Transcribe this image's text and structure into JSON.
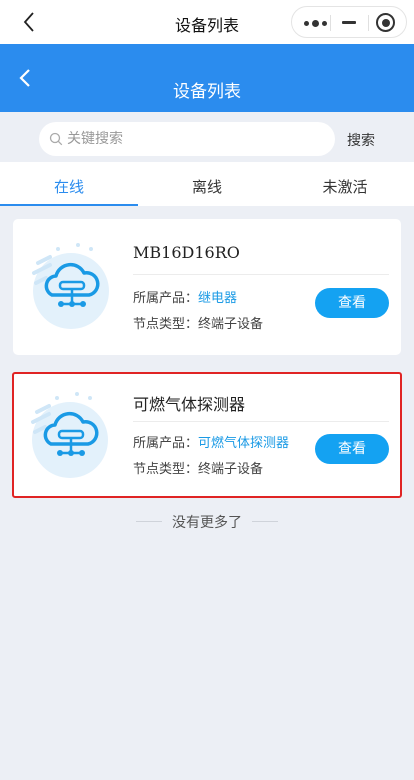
{
  "system_bar": {
    "title": "设备列表"
  },
  "app_header": {
    "title": "设备列表",
    "color": "#2b8cee"
  },
  "search": {
    "placeholder": "关键搜索",
    "value": "",
    "button_label": "搜索"
  },
  "tabs": [
    {
      "label": "在线",
      "active": true
    },
    {
      "label": "离线",
      "active": false
    },
    {
      "label": "未激活",
      "active": false
    }
  ],
  "devices": [
    {
      "name": "MB16D16RO",
      "product_label": "所属产品：",
      "product_value": "继电器",
      "node_label": "节点类型：",
      "node_value": "终端子设备",
      "button_label": "查看",
      "icon": "cloud-network-icon"
    },
    {
      "name": "可燃气体探测器",
      "product_label": "所属产品：",
      "product_value": "可燃气体探测器",
      "node_label": "节点类型：",
      "node_value": "终端子设备",
      "button_label": "查看",
      "icon": "cloud-network-icon",
      "highlighted": true
    }
  ],
  "footer": {
    "no_more": "没有更多了"
  },
  "colors": {
    "accent": "#2b8cee",
    "button": "#14a2f2",
    "link": "#1a9ae5",
    "highlight_border": "#e02424"
  }
}
